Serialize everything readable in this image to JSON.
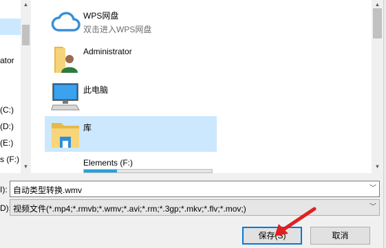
{
  "nav": {
    "items": [
      {
        "label": "ator"
      },
      {
        "label": "(C:)"
      },
      {
        "label": "(D:)"
      },
      {
        "label": "(E:)"
      },
      {
        "label": "s (F:)"
      }
    ]
  },
  "list": {
    "items": [
      {
        "title": "WPS网盘",
        "subtitle": "双击进入WPS网盘",
        "icon": "cloud-icon"
      },
      {
        "title": "Administrator",
        "icon": "user-folder-icon"
      },
      {
        "title": "此电脑",
        "icon": "computer-icon"
      },
      {
        "title": "库",
        "icon": "library-folder-icon"
      },
      {
        "title": "Elements (F:)",
        "icon": "drive-icon",
        "used_fraction": 0.26
      }
    ]
  },
  "filename": {
    "label_fragment": "I):",
    "value": "自动类型转换.wmv"
  },
  "filetype": {
    "label_fragment": "D):",
    "value": "视频文件(*.mp4;*.rmvb;*.wmv;*.avi;*.rm;*.3gp;*.mkv;*.flv;*.mov;)"
  },
  "buttons": {
    "save": "保存(S)",
    "cancel": "取消"
  },
  "colors": {
    "selection": "#cce8ff",
    "default_button_border": "#0078d7",
    "annotation": "#e02020"
  }
}
